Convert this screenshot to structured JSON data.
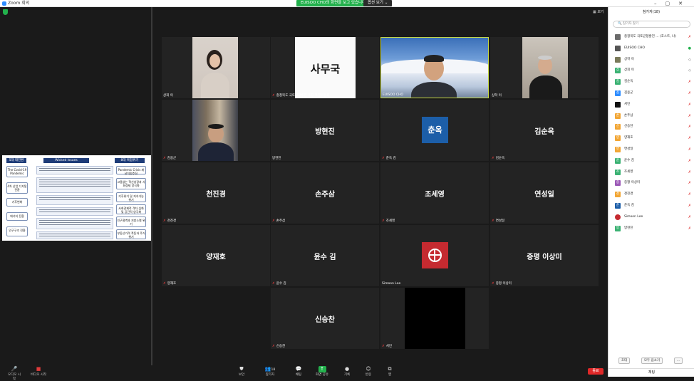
{
  "titlebar": {
    "app_title": "Zoom 회의",
    "share_banner": "EUISOO CHO의 화면을 보고 있습니다",
    "view_options": "옵션 보기 ⌄"
  },
  "top_right": {
    "view_label": "보기"
  },
  "tiles": [
    {
      "label": "상희 이",
      "big_name": "",
      "kind": "photo-room",
      "muted": false
    },
    {
      "label": "충청북도 국토균형발전 추진 특별위원회",
      "big_name": "",
      "kind": "sammu",
      "muted": true,
      "sign_text": "사무국"
    },
    {
      "label": "EUISOO CHO",
      "big_name": "",
      "kind": "mountain",
      "muted": false,
      "active": true
    },
    {
      "label": "상학 이",
      "big_name": "",
      "kind": "office",
      "muted": false
    },
    {
      "label": "김용군",
      "big_name": "",
      "kind": "books",
      "muted": true
    },
    {
      "label": "방현진",
      "big_name": "방현진",
      "kind": "name",
      "muted": false
    },
    {
      "label": "춘옥 김",
      "big_name": "",
      "kind": "avatar-blue",
      "muted": true,
      "avatar_text": "춘옥"
    },
    {
      "label": "김순옥",
      "big_name": "김순옥",
      "kind": "name",
      "muted": true
    },
    {
      "label": "천진경",
      "big_name": "천진경",
      "kind": "name",
      "muted": true
    },
    {
      "label": "손주삼",
      "big_name": "손주삼",
      "kind": "name",
      "muted": true
    },
    {
      "label": "조세영",
      "big_name": "조세영",
      "kind": "name",
      "muted": true
    },
    {
      "label": "연성일",
      "big_name": "연성일",
      "kind": "name",
      "muted": true
    },
    {
      "label": "양재호",
      "big_name": "양재호",
      "kind": "name",
      "muted": true
    },
    {
      "label": "윤수 김",
      "big_name": "윤수 김",
      "kind": "name",
      "muted": true
    },
    {
      "label": "Simoon Lee",
      "big_name": "",
      "kind": "avatar-red",
      "muted": false
    },
    {
      "label": "증평 이상미",
      "big_name": "증평 이상미",
      "kind": "name",
      "muted": true
    },
    {
      "label": "신승찬",
      "big_name": "신승찬",
      "kind": "name",
      "muted": true
    },
    {
      "label": "서민",
      "big_name": "",
      "kind": "dark",
      "muted": true
    }
  ],
  "slide": {
    "col1_header": "5대 대전환",
    "col2_header": "Wicked Issues",
    "col3_header": "8대 복합위기",
    "left_boxes": [
      "The Covid-19 Pandemic",
      "4차 산업 디지털 전환",
      "기후변화",
      "에너지 전환",
      "인구구조 전환"
    ],
    "right_boxes": [
      "Pandemic Crisis 재난지원추진",
      "고용없는 혁신성장과 사회경제 양극화",
      "기후위기 및 지속가능 위기",
      "사회경제적 격차 심화 및 공간적 양극화",
      "인구절벽과 지방소멸 위기",
      "부동산가격 폭등과 주거위기"
    ]
  },
  "toolbar": {
    "audio": "오디오 시작",
    "video": "비디오 시작",
    "security": "보안",
    "participants": "참가자",
    "participants_count": "18",
    "chat": "채팅",
    "share": "화면 공유",
    "record": "기록",
    "reactions": "반응",
    "apps": "앱",
    "end": "종료"
  },
  "participants_panel": {
    "title": "참가자(18)",
    "search_placeholder": "참가자 찾기",
    "people": [
      {
        "name": "충청북도 국토균형발전 ... (호스트, 나)",
        "initial": "",
        "color": "#6b6b6b",
        "mic": "✗"
      },
      {
        "name": "EUISOO CHO",
        "initial": "",
        "color": "#555",
        "mic": "●"
      },
      {
        "name": "상학 이",
        "initial": "",
        "color": "#7a7a5a",
        "mic": "◇"
      },
      {
        "name": "상희 이",
        "initial": "상",
        "color": "#3bb273",
        "mic": "◇"
      },
      {
        "name": "김순옥",
        "initial": "김",
        "color": "#3bb273",
        "mic": "✗"
      },
      {
        "name": "김용군",
        "initial": "김",
        "color": "#2d8cff",
        "mic": "✗"
      },
      {
        "name": "서민",
        "initial": "",
        "color": "#111",
        "mic": "✗"
      },
      {
        "name": "손주삼",
        "initial": "손",
        "color": "#f2a634",
        "mic": "✗"
      },
      {
        "name": "신승찬",
        "initial": "신",
        "color": "#f2a634",
        "mic": "✗"
      },
      {
        "name": "양재호",
        "initial": "양",
        "color": "#f2a634",
        "mic": "✗"
      },
      {
        "name": "연성일",
        "initial": "연",
        "color": "#f2a634",
        "mic": "✗"
      },
      {
        "name": "윤수 김",
        "initial": "윤",
        "color": "#3bb273",
        "mic": "✗"
      },
      {
        "name": "조세영",
        "initial": "조",
        "color": "#3bb273",
        "mic": "✗"
      },
      {
        "name": "증평 이상미",
        "initial": "증",
        "color": "#9b59b6",
        "mic": "✗"
      },
      {
        "name": "천진경",
        "initial": "천",
        "color": "#f2a634",
        "mic": "✗"
      },
      {
        "name": "춘옥 김",
        "initial": "춘",
        "color": "#1c5ea8",
        "mic": "✗"
      },
      {
        "name": "Simoon Lee",
        "initial": "",
        "color": "#c52a30",
        "mic": "✗"
      },
      {
        "name": "방현진",
        "initial": "방",
        "color": "#3bb273",
        "mic": "✗"
      }
    ],
    "invite": "초대",
    "mute_all": "모두 음소거",
    "more": "...",
    "chat_header": "채팅"
  }
}
